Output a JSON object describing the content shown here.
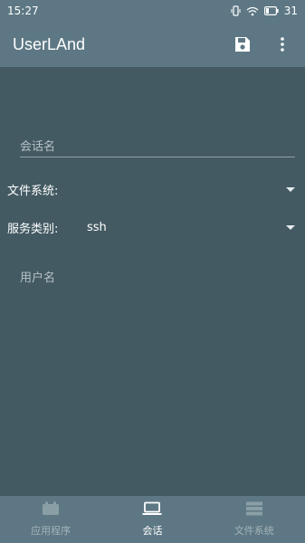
{
  "status_bar": {
    "time": "15:27",
    "battery": "31",
    "icons": [
      "vibrate-icon",
      "wifi-icon",
      "battery-icon"
    ]
  },
  "app_bar": {
    "title": "UserLAnd",
    "actions": [
      "save-icon",
      "more-vert-icon"
    ]
  },
  "form": {
    "session_name_placeholder": "会话名",
    "filesystem_label": "文件系统:",
    "filesystem_value": "",
    "service_type_label": "服务类别:",
    "service_type_value": "ssh",
    "username_placeholder": "用户名"
  },
  "bottom_nav": {
    "items": [
      {
        "label": "应用程序",
        "icon": "apps-icon",
        "active": false
      },
      {
        "label": "会话",
        "icon": "laptop-icon",
        "active": true
      },
      {
        "label": "文件系统",
        "icon": "storage-icon",
        "active": false
      }
    ]
  },
  "colors": {
    "primary": "#5d7884",
    "background": "#435a63",
    "text": "#ffffff",
    "hint": "#b7c2c6"
  }
}
